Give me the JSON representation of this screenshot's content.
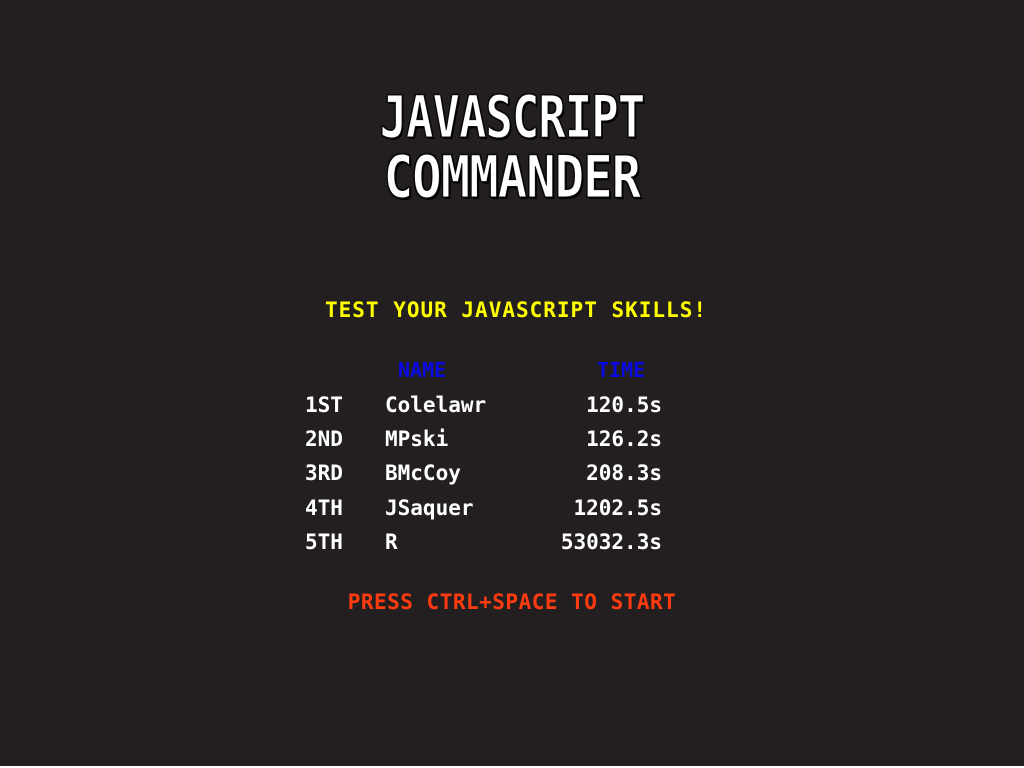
{
  "logo": {
    "line1": "JAVASCRIPT",
    "line2": "COMMANDER"
  },
  "tagline": "TEST YOUR JAVASCRIPT SKILLS!",
  "leaderboard": {
    "headers": {
      "name": "NAME",
      "time": "TIME"
    },
    "rows": [
      {
        "rank": "1ST",
        "name": "Colelawr",
        "time": "120.5s"
      },
      {
        "rank": "2ND",
        "name": "MPski",
        "time": "126.2s"
      },
      {
        "rank": "3RD",
        "name": "BMcCoy",
        "time": "208.3s"
      },
      {
        "rank": "4TH",
        "name": "JSaquer",
        "time": "1202.5s"
      },
      {
        "rank": "5TH",
        "name": "R",
        "time": "53032.3s"
      }
    ]
  },
  "prompt": "PRESS CTRL+SPACE TO START",
  "colors": {
    "background": "#231f20",
    "tagline": "#ffff00",
    "header": "#0a0ae6",
    "entries": "#ffffff",
    "prompt": "#ff3b0f"
  }
}
